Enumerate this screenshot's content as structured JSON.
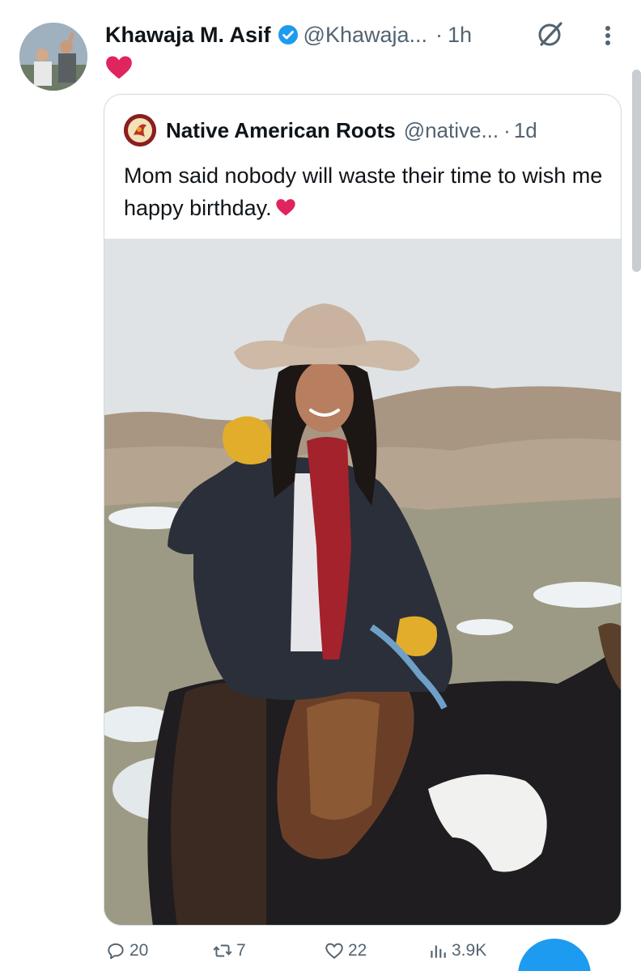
{
  "tweet": {
    "author_name": "Khawaja M. Asif",
    "handle": "@Khawaja...",
    "separator": "·",
    "time": "1h",
    "verified": true,
    "text_icon": "red-heart-icon"
  },
  "quote": {
    "author_name": "Native American Roots",
    "handle": "@native...",
    "separator": "·",
    "time": "1d",
    "text": "Mom said nobody will waste their time to wish me happy birthday.",
    "text_emoji": "red-heart-icon",
    "media_alt": "photo-woman-cowboy-hat-on-horse"
  },
  "actions": {
    "replies": "20",
    "reposts": "7",
    "likes": "22",
    "views": "3.9K"
  },
  "colors": {
    "accent": "#1d9bf0",
    "muted": "#536471",
    "heart": "#e0245e"
  }
}
